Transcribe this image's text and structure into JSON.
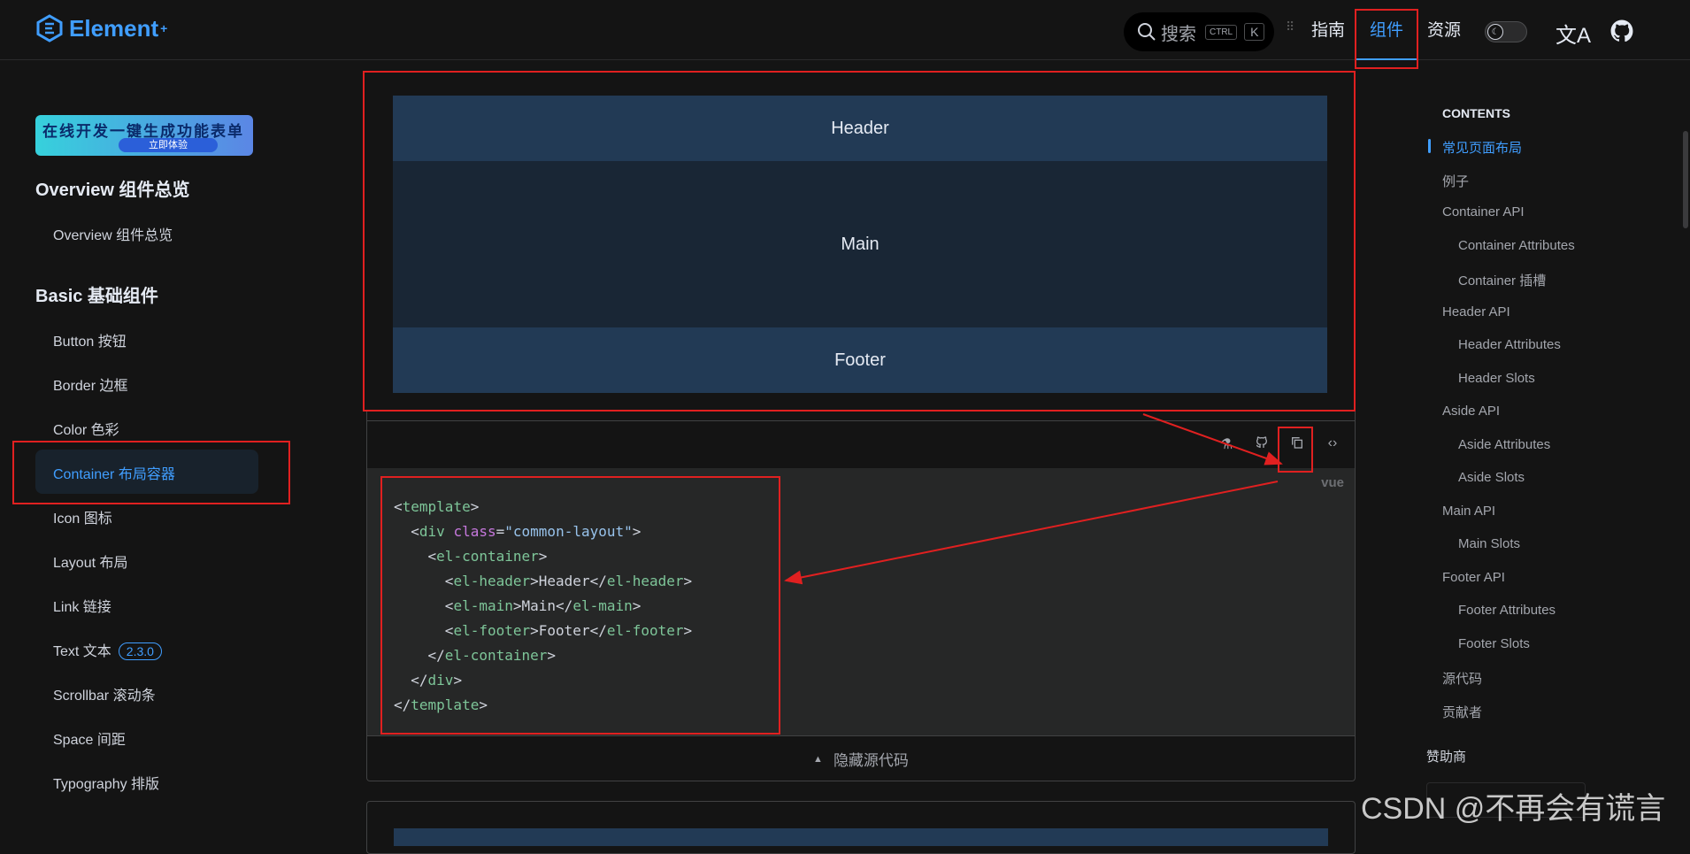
{
  "app": {
    "logo_text": "Element",
    "logo_sup": "+"
  },
  "topnav": {
    "search_label": "搜索",
    "shortcut_ctrl": "CTRL",
    "shortcut_key": "K",
    "items": [
      {
        "label": "指南"
      },
      {
        "label": "组件"
      },
      {
        "label": "资源"
      }
    ],
    "translate_icon": "文A"
  },
  "sidebar": {
    "banner_text": "在线开发一键生成功能表单",
    "banner_button": "立即体验",
    "groups": [
      {
        "title": "Overview 组件总览",
        "items": [
          "Overview 组件总览"
        ]
      },
      {
        "title": "Basic 基础组件",
        "items": [
          "Button 按钮",
          "Border 边框",
          "Color 色彩",
          "Container 布局容器",
          "Icon 图标",
          "Layout 布局",
          "Link 链接",
          "Text 文本",
          "Scrollbar 滚动条",
          "Space 间距",
          "Typography 排版"
        ]
      }
    ],
    "text_badge": "2.3.0",
    "active_item": "Container 布局容器"
  },
  "demo": {
    "header": "Header",
    "main": "Main",
    "footer": "Footer",
    "lang": "vue",
    "hide_source": "隐藏源代码"
  },
  "toc": {
    "title": "CONTENTS",
    "items": [
      "常见页面布局",
      "例子",
      "Container API",
      "Container Attributes",
      "Container 插槽",
      "Header API",
      "Header Attributes",
      "Header Slots",
      "Aside API",
      "Aside Attributes",
      "Aside Slots",
      "Main API",
      "Main Slots",
      "Footer API",
      "Footer Attributes",
      "Footer Slots",
      "源代码",
      "贡献者"
    ],
    "sponsor_title": "赞助商"
  },
  "watermark": "CSDN @不再会有谎言",
  "colors": {
    "accent": "#409eff",
    "annotation": "#e02020"
  }
}
